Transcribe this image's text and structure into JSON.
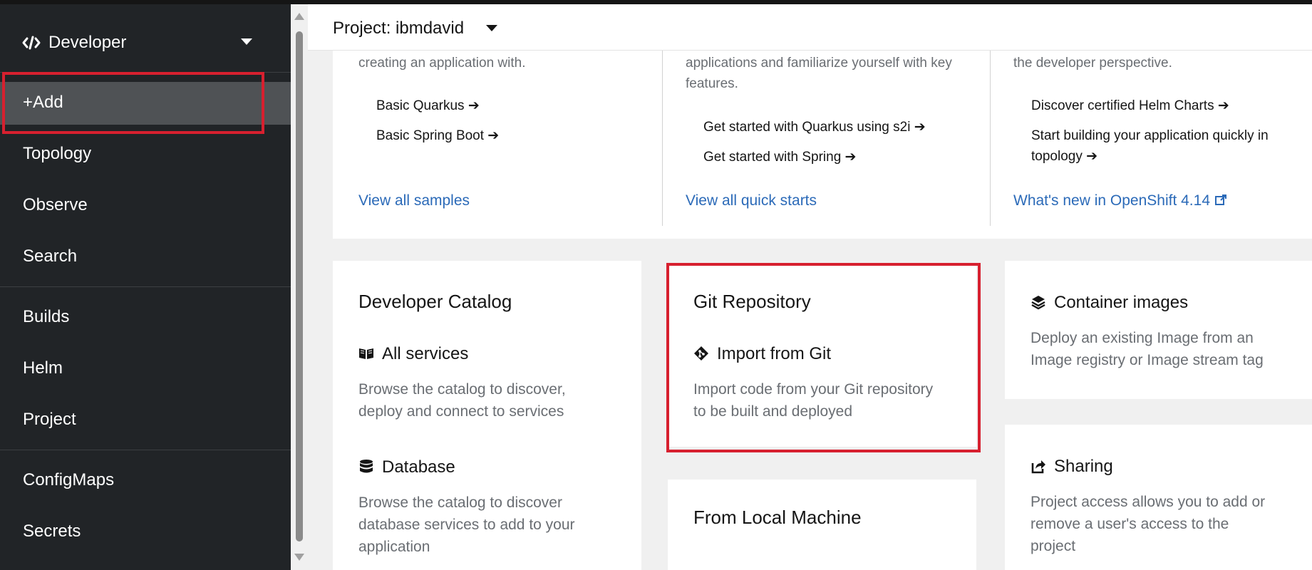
{
  "perspective": {
    "label": "Developer"
  },
  "sidebar": {
    "items": [
      {
        "label": "+Add"
      },
      {
        "label": "Topology"
      },
      {
        "label": "Observe"
      },
      {
        "label": "Search"
      },
      {
        "label": "Builds"
      },
      {
        "label": "Helm"
      },
      {
        "label": "Project"
      },
      {
        "label": "ConfigMaps"
      },
      {
        "label": "Secrets"
      }
    ]
  },
  "project": {
    "label": "Project: ibmdavid"
  },
  "getting_started": {
    "columns": [
      {
        "text": "creating an application with.",
        "links": [
          "Basic Quarkus ➔",
          "Basic Spring Boot ➔"
        ],
        "view": "View all samples"
      },
      {
        "text": "applications and familiarize yourself with key features.",
        "links": [
          "Get started with Quarkus using s2i ➔",
          "Get started with Spring ➔"
        ],
        "view": "View all quick starts"
      },
      {
        "text": "the developer perspective.",
        "links": [
          "Discover certified Helm Charts ➔",
          "Start building your application quickly in topology ➔"
        ],
        "view": "What's new in OpenShift 4.14"
      }
    ]
  },
  "developer_catalog": {
    "title": "Developer Catalog",
    "items": [
      {
        "label": "All services",
        "desc": "Browse the catalog to discover, deploy and connect to services"
      },
      {
        "label": "Database",
        "desc": "Browse the catalog to discover database services to add to your application"
      }
    ]
  },
  "git_repository": {
    "title": "Git Repository",
    "items": [
      {
        "label": "Import from Git",
        "desc": "Import code from your Git repository to be built and deployed"
      }
    ]
  },
  "local_machine": {
    "title": "From Local Machine"
  },
  "container_images": {
    "label": "Container images",
    "desc": "Deploy an existing Image from an Image registry or Image stream tag"
  },
  "sharing": {
    "label": "Sharing",
    "desc": "Project access allows you to add or remove a user's access to the project"
  },
  "colors": {
    "highlight": "#d7202f",
    "link": "#2b6ab8",
    "sidebar_bg": "#212427"
  }
}
